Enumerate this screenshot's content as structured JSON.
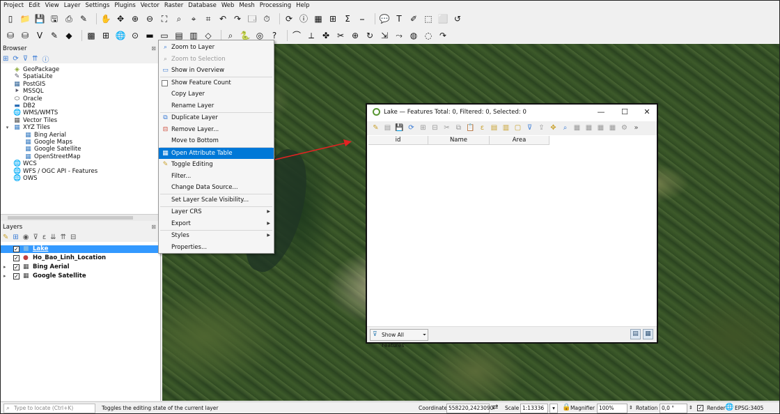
{
  "menubar": {
    "items": [
      "Project",
      "Edit",
      "View",
      "Layer",
      "Settings",
      "Plugins",
      "Vector",
      "Raster",
      "Database",
      "Web",
      "Mesh",
      "Processing",
      "Help"
    ]
  },
  "toolbar1": {
    "icons": [
      "new-project-icon",
      "open-project-icon",
      "save-project-icon",
      "save-as-icon",
      "print-layout-icon",
      "style-manager-icon",
      "pan-icon",
      "pan-to-selection-icon",
      "zoom-in-icon",
      "zoom-out-icon",
      "zoom-full-icon",
      "zoom-to-selection-icon",
      "zoom-to-layer-icon",
      "zoom-native-icon",
      "zoom-last-icon",
      "zoom-next-icon",
      "new-map-view-icon",
      "temporal-controller-icon",
      "refresh-icon",
      "identify-icon",
      "open-attribute-table-icon",
      "field-calculator-icon",
      "statistical-summary-icon",
      "measure-icon",
      "annotation-icon",
      "label-icon",
      "digitize-icon",
      "select-icon",
      "deselect-icon",
      "edit-icon"
    ],
    "glyphs": [
      "▯",
      "📁",
      "💾",
      "🖫",
      "⎙",
      "✎",
      "✋",
      "✥",
      "⊕",
      "⊖",
      "⛶",
      "⌕",
      "⌖",
      "⌗",
      "↶",
      "↷",
      "🗔",
      "⏱",
      "⟳",
      "ⓘ",
      "▦",
      "⊞",
      "Σ",
      "⎯",
      "💬",
      "T",
      "✐",
      "⬚",
      "⬜",
      "↺"
    ]
  },
  "toolbar2": {
    "icons": [
      "data-source-manager-icon",
      "new-geopackage-icon",
      "new-shapefile-icon",
      "new-temporary-layer-icon",
      "add-vector-icon",
      "add-raster-icon",
      "add-wms-icon",
      "add-wfs-icon",
      "add-delimited-icon",
      "add-postgis-icon",
      "add-spatialite-icon",
      "add-mssql-icon",
      "add-oracle-icon",
      "add-virtual-icon",
      "metasearch-icon",
      "python-console-icon",
      "plugins-icon",
      "help-icon",
      "digitize-line-icon",
      "advanced-digitize-icon",
      "node-tool-icon",
      "split-icon",
      "merge-icon",
      "rotate-icon",
      "offset-icon",
      "reshape-icon",
      "fill-ring-icon",
      "delete-ring-icon",
      "redo-icon"
    ],
    "glyphs": [
      "⛁",
      "⛁",
      "V",
      "✎",
      "◆",
      "▩",
      "⊞",
      "🌐",
      "⊙",
      "▬",
      "▭",
      "▤",
      "▥",
      "◇",
      "⌕",
      "🐍",
      "◎",
      "?",
      "⌒",
      "⟂",
      "✤",
      "✂",
      "⊕",
      "↻",
      "⇲",
      "⤳",
      "◍",
      "◌",
      "↷"
    ]
  },
  "browser": {
    "title": "Browser",
    "items": [
      {
        "label": "GeoPackage",
        "icon": "geopackage-icon",
        "glyph": "◈",
        "color": "#8aa832"
      },
      {
        "label": "SpatiaLite",
        "icon": "spatialite-icon",
        "glyph": "✎",
        "color": "#556"
      },
      {
        "label": "PostGIS",
        "icon": "postgis-icon",
        "glyph": "▦",
        "color": "#336699"
      },
      {
        "label": "MSSQL",
        "icon": "mssql-icon",
        "glyph": "⯈",
        "color": "#556"
      },
      {
        "label": "Oracle",
        "icon": "oracle-icon",
        "glyph": "⬭",
        "color": "#444"
      },
      {
        "label": "DB2",
        "icon": "db2-icon",
        "glyph": "▬",
        "color": "#2a6db4"
      },
      {
        "label": "WMS/WMTS",
        "icon": "wms-icon",
        "glyph": "🌐",
        "color": "#3a7bd5"
      },
      {
        "label": "Vector Tiles",
        "icon": "vector-tiles-icon",
        "glyph": "▦",
        "color": "#555"
      },
      {
        "label": "XYZ Tiles",
        "icon": "xyz-tiles-icon",
        "glyph": "▦",
        "color": "#3e80c4"
      },
      {
        "label": "Bing Aerial",
        "icon": "tile-layer-icon",
        "glyph": "▦",
        "color": "#3e80c4"
      },
      {
        "label": "Google Maps",
        "icon": "tile-layer-icon",
        "glyph": "▦",
        "color": "#3e80c4"
      },
      {
        "label": "Google Satellite",
        "icon": "tile-layer-icon",
        "glyph": "▦",
        "color": "#3e80c4"
      },
      {
        "label": "OpenStreetMap",
        "icon": "tile-layer-icon",
        "glyph": "▦",
        "color": "#3e80c4"
      },
      {
        "label": "WCS",
        "icon": "wcs-icon",
        "glyph": "🌐",
        "color": "#3a7bd5"
      },
      {
        "label": "WFS / OGC API - Features",
        "icon": "wfs-icon",
        "glyph": "🌐",
        "color": "#3a7bd5"
      },
      {
        "label": "OWS",
        "icon": "ows-icon",
        "glyph": "🌐",
        "color": "#3a7bd5"
      }
    ]
  },
  "layers": {
    "title": "Layers",
    "items": [
      {
        "label": "Lake",
        "icon": "polygon-layer-icon",
        "glyph": "■",
        "color": "#7ab8e8",
        "selected": true,
        "checked": "✓"
      },
      {
        "label": "Ho_Bao_Linh_Location",
        "icon": "point-layer-icon",
        "glyph": "●",
        "color": "#c04040",
        "selected": false,
        "checked": "✓"
      },
      {
        "label": "Bing Aerial",
        "icon": "raster-layer-icon",
        "glyph": "▦",
        "color": "#444",
        "selected": false,
        "checked": "✓"
      },
      {
        "label": "Google Satellite",
        "icon": "raster-layer-icon",
        "glyph": "▦",
        "color": "#444",
        "selected": false,
        "checked": "✓"
      }
    ]
  },
  "context_menu": {
    "items": [
      {
        "label": "Zoom to Layer",
        "icon": "zoom-layer-icon",
        "glyph": "⌕",
        "disabled": false
      },
      {
        "label": "Zoom to Selection",
        "icon": "zoom-selection-icon",
        "glyph": "⌕",
        "disabled": true
      },
      {
        "label": "Show in Overview",
        "icon": "overview-icon",
        "glyph": "▭",
        "disabled": false
      },
      {
        "label": "Show Feature Count",
        "icon": "checkbox-icon",
        "glyph": "",
        "disabled": false
      },
      {
        "label": "Copy Layer",
        "icon": "",
        "glyph": "",
        "disabled": false
      },
      {
        "label": "Rename Layer",
        "icon": "",
        "glyph": "",
        "disabled": false
      },
      {
        "label": "Duplicate Layer",
        "icon": "duplicate-icon",
        "glyph": "⧉",
        "disabled": false
      },
      {
        "label": "Remove Layer...",
        "icon": "remove-icon",
        "glyph": "⊟",
        "disabled": false
      },
      {
        "label": "Move to Bottom",
        "icon": "",
        "glyph": "",
        "disabled": false
      },
      {
        "label": "Open Attribute Table",
        "icon": "attribute-table-icon",
        "glyph": "▦",
        "disabled": false,
        "highlight": true
      },
      {
        "label": "Toggle Editing",
        "icon": "pencil-icon",
        "glyph": "✎",
        "disabled": false
      },
      {
        "label": "Filter...",
        "icon": "",
        "glyph": "",
        "disabled": false
      },
      {
        "label": "Change Data Source...",
        "icon": "",
        "glyph": "",
        "disabled": false
      },
      {
        "label": "Set Layer Scale Visibility...",
        "icon": "",
        "glyph": "",
        "disabled": false
      },
      {
        "label": "Layer CRS",
        "icon": "",
        "glyph": "",
        "disabled": false,
        "submenu": true
      },
      {
        "label": "Export",
        "icon": "",
        "glyph": "",
        "disabled": false,
        "submenu": true
      },
      {
        "label": "Styles",
        "icon": "",
        "glyph": "",
        "disabled": false,
        "submenu": true
      },
      {
        "label": "Properties...",
        "icon": "",
        "glyph": "",
        "disabled": false
      }
    ],
    "submenu_arrow": "▶"
  },
  "attribute_table": {
    "title": "Lake — Features Total: 0, Filtered: 0, Selected: 0",
    "window_buttons": {
      "minimize": "—",
      "maximize": "☐",
      "close": "✕"
    },
    "columns": [
      "id",
      "Name",
      "Area"
    ],
    "rows": [],
    "toolbar_icons": [
      "toggle-editing-icon",
      "multi-edit-icon",
      "save-edits-icon",
      "reload-icon",
      "add-feature-icon",
      "delete-feature-icon",
      "cut-icon",
      "copy-icon",
      "paste-icon",
      "expression-select-icon",
      "select-all-icon",
      "invert-selection-icon",
      "deselect-icon",
      "filter-selected-icon",
      "move-selection-top-icon",
      "pan-to-selected-icon",
      "zoom-to-selected-icon",
      "new-field-icon",
      "delete-field-icon",
      "field-calculator-icon",
      "conditional-formatting-icon",
      "actions-icon",
      "more-icon"
    ],
    "toolbar_glyphs": [
      "✎",
      "▤",
      "💾",
      "⟳",
      "⊞",
      "⊟",
      "✂",
      "⧉",
      "📋",
      "ε",
      "▤",
      "▥",
      "▢",
      "⊽",
      "⇪",
      "✥",
      "⌕",
      "▦",
      "▦",
      "▦",
      "▦",
      "⚙",
      "»"
    ],
    "footer_button": "Show All Features",
    "footer_icon": "⏷"
  },
  "statusbar": {
    "locator_placeholder": "Type to locate (Ctrl+K)",
    "message": "Toggles the editing state of the current layer",
    "coordinate_label": "Coordinate",
    "coordinate_value": "558220,2423090",
    "scale_label": "Scale",
    "scale_value": "1:13336",
    "magnifier_label": "Magnifier",
    "magnifier_value": "100%",
    "rotation_label": "Rotation",
    "rotation_value": "0,0 °",
    "render_label": "Render",
    "crs_label": "EPSG:3405"
  }
}
